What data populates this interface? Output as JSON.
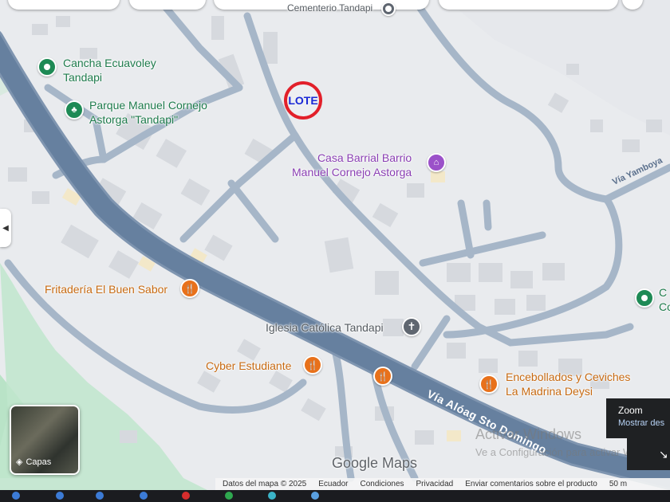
{
  "map": {
    "cemetery_label": "Cementerio Tandapi",
    "road_label": "Vía Alóag Sto Domingo",
    "secondary_road_label": "Vía Yamboya",
    "lote_label": "LOTE"
  },
  "pois": {
    "cancha_line1": "Cancha Ecuavoley",
    "cancha_line2": "Tandapi",
    "parque_line1": "Parque Manuel Cornejo",
    "parque_line2": "Astorga \"Tandapi\"",
    "casa_line1": "Casa Barrial Barrio",
    "casa_line2": "Manuel Cornejo Astorga",
    "fritaderia": "Fritadería El Buen Sabor",
    "iglesia": "Iglesia Católica Tandapi",
    "cyber": "Cyber Estudiante",
    "encebollados_line1": "Encebollados y Ceviches",
    "encebollados_line2": "La Madrina Deysi",
    "right_edge_label": "C",
    "right_edge_label2": "Co"
  },
  "controls": {
    "layers_label": "Capas",
    "zoom_title": "Zoom",
    "zoom_link": "Mostrar des",
    "watermark_line1": "Activar Windows",
    "watermark_line2": "Ve a Configuración para activar Wi",
    "google_logo": "Google Maps"
  },
  "attribution": {
    "map_data": "Datos del mapa © 2025",
    "country": "Ecuador",
    "terms": "Condiciones",
    "privacy": "Privacidad",
    "feedback": "Enviar comentarios sobre el producto",
    "scale": "50 m"
  },
  "colors": {
    "main_road": "#66809f",
    "main_road_edge": "#7f95b0",
    "street": "#a6b6c8",
    "block": "#d6d9de",
    "green_area": "#b9e3c7",
    "lote_ring": "#e2202a",
    "lote_text": "#1a29d6"
  }
}
